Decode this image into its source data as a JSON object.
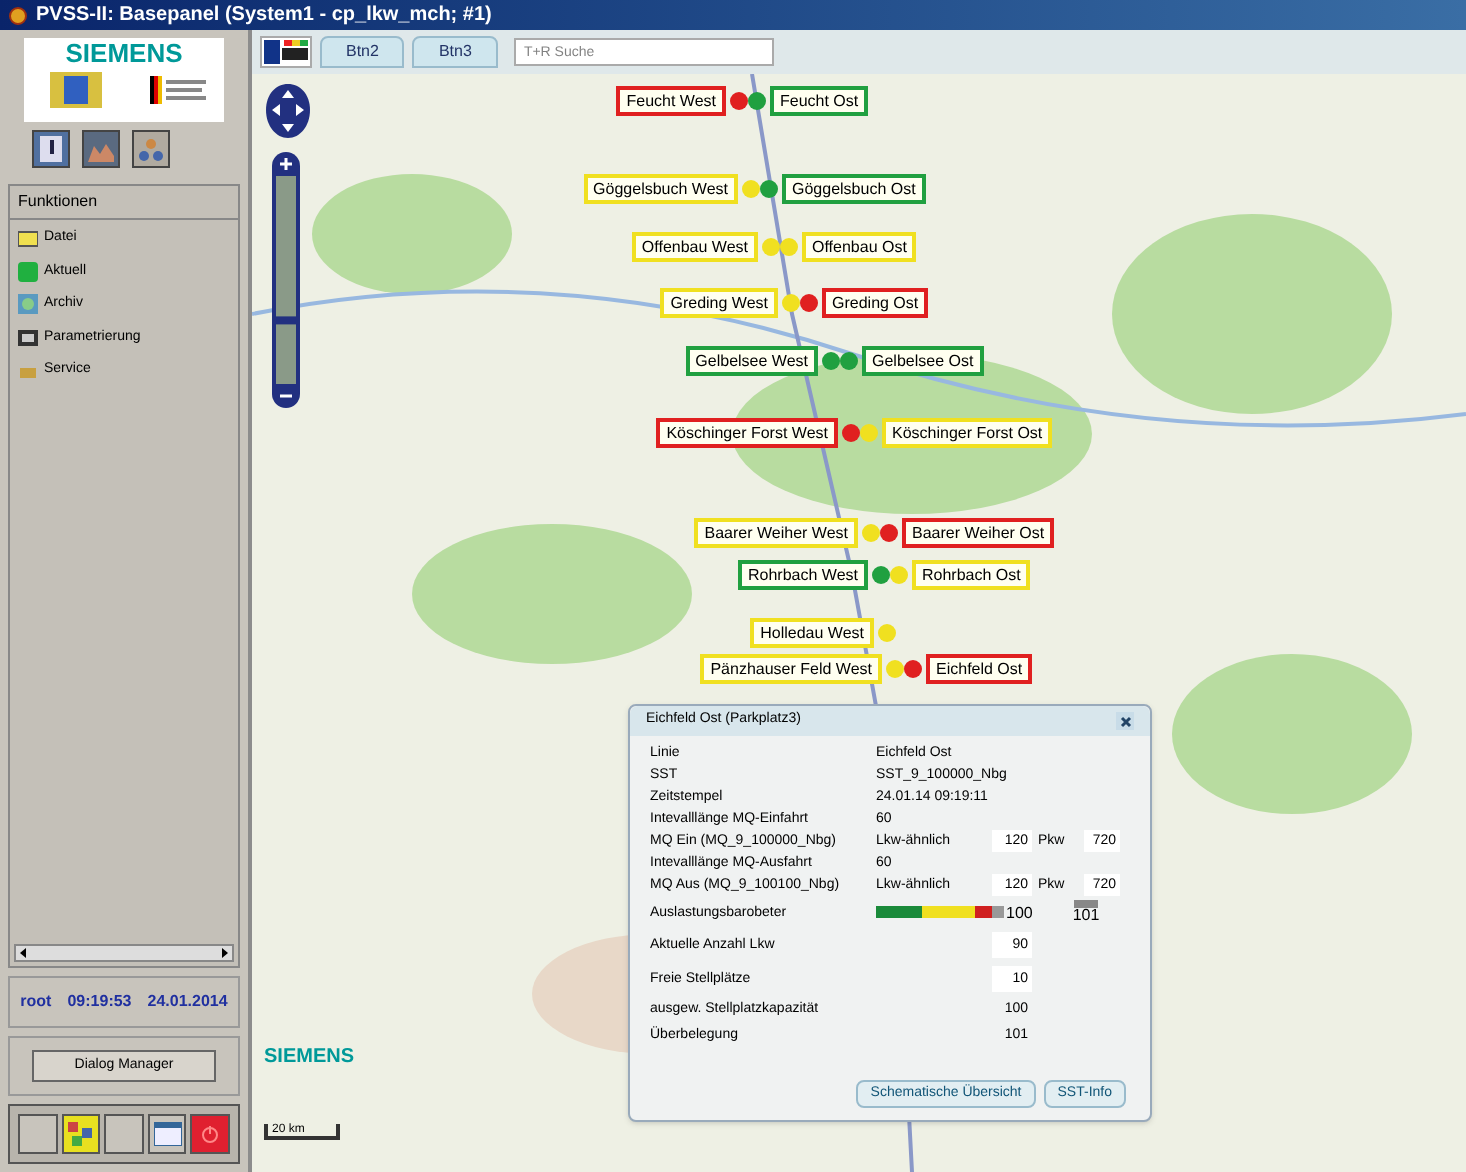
{
  "window": {
    "title": "PVSS-II: Basepanel (System1 - cp_lkw_mch; #1)"
  },
  "sidebar": {
    "logo_text": "SIEMENS",
    "section_title": "Funktionen",
    "items": [
      {
        "label": "Datei",
        "kind": "folder"
      },
      {
        "label": "Aktuell",
        "kind": "live"
      },
      {
        "label": "Archiv",
        "kind": "archive"
      },
      {
        "label": "Parametrierung",
        "kind": "settings"
      },
      {
        "label": "Service",
        "kind": "service"
      }
    ],
    "status": {
      "user": "root",
      "time": "09:19:53",
      "date": "24.01.2014"
    },
    "dialog_button": "Dialog Manager"
  },
  "toolbar": {
    "tabs": [
      {
        "label": "Btn2",
        "selected": false
      },
      {
        "label": "Btn3",
        "selected": false
      }
    ],
    "search": {
      "placeholder": "T+R Suche"
    }
  },
  "map": {
    "zoom": {
      "level": 0.3
    },
    "brand": "SIEMENS",
    "scale": "20 km",
    "stations": [
      {
        "west": {
          "label": "Feucht West",
          "color": "#e02020"
        },
        "east": {
          "label": "Feucht Ost",
          "color": "#20a040"
        }
      },
      {
        "west": {
          "label": "Göggelsbuch West",
          "color": "#f0e020"
        },
        "east": {
          "label": "Göggelsbuch Ost",
          "color": "#20a040"
        }
      },
      {
        "west": {
          "label": "Offenbau West",
          "color": "#f0e020"
        },
        "east": {
          "label": "Offenbau Ost",
          "color": "#f0e020"
        }
      },
      {
        "west": {
          "label": "Greding West",
          "color": "#f0e020"
        },
        "east": {
          "label": "Greding Ost",
          "color": "#e02020"
        }
      },
      {
        "west": {
          "label": "Gelbelsee West",
          "color": "#20a040"
        },
        "east": {
          "label": "Gelbelsee Ost",
          "color": "#20a040"
        }
      },
      {
        "west": {
          "label": "Köschinger Forst West",
          "color": "#e02020"
        },
        "east": {
          "label": "Köschinger Forst Ost",
          "color": "#f0e020"
        }
      },
      {
        "west": {
          "label": "Baarer Weiher West",
          "color": "#f0e020"
        },
        "east": {
          "label": "Baarer Weiher Ost",
          "color": "#e02020"
        }
      },
      {
        "west": {
          "label": "Rohrbach West",
          "color": "#20a040"
        },
        "east": {
          "label": "Rohrbach Ost",
          "color": "#f0e020"
        }
      },
      {
        "west": {
          "label": "Holledau West",
          "color": "#f0e020"
        }
      },
      {
        "west": {
          "label": "Pänzhauser Feld West",
          "color": "#f0e020"
        },
        "east": {
          "label": "Eichfeld Ost",
          "color": "#e02020"
        }
      }
    ]
  },
  "popup": {
    "title": "Eichfeld Ost (Parkplatz3)",
    "rows": [
      {
        "kind": "pair",
        "label": "Linie",
        "value": "Eichfeld Ost"
      },
      {
        "kind": "pair",
        "label": "SST",
        "value": "SST_9_100000_Nbg"
      },
      {
        "kind": "pair",
        "label": "Zeitstempel",
        "value": "24.01.14 09:19:11"
      },
      {
        "kind": "pair",
        "label": "Intevalllänge MQ-Einfahrt",
        "value": "60"
      },
      {
        "kind": "counts",
        "label": "MQ Ein (MQ_9_100000_Nbg)",
        "value": "Lkw-ähnlich",
        "count": "120",
        "label2": "Pkw",
        "count2": "720"
      },
      {
        "kind": "pair",
        "label": "Intevalllänge MQ-Ausfahrt",
        "value": "60"
      },
      {
        "kind": "counts",
        "label": "MQ Aus (MQ_9_100100_Nbg)",
        "value": "Lkw-ähnlich",
        "count": "120",
        "label2": "Pkw",
        "count2": "720"
      },
      {
        "kind": "meter",
        "label": "Auslastungsbarobeter",
        "level": 0.9,
        "value": "100",
        "value2": "101"
      },
      {
        "kind": "boxed",
        "label": "Aktuelle Anzahl Lkw",
        "value": "90"
      },
      {
        "kind": "boxed",
        "label": "Freie Stellplätze",
        "value": "10"
      },
      {
        "kind": "plain",
        "label": "ausgew. Stellplatzkapazität",
        "value": "100"
      },
      {
        "kind": "plain",
        "label": "Überbelegung",
        "value": "101"
      }
    ],
    "buttons": [
      "Schematische Übersicht",
      "SST-Info"
    ]
  }
}
